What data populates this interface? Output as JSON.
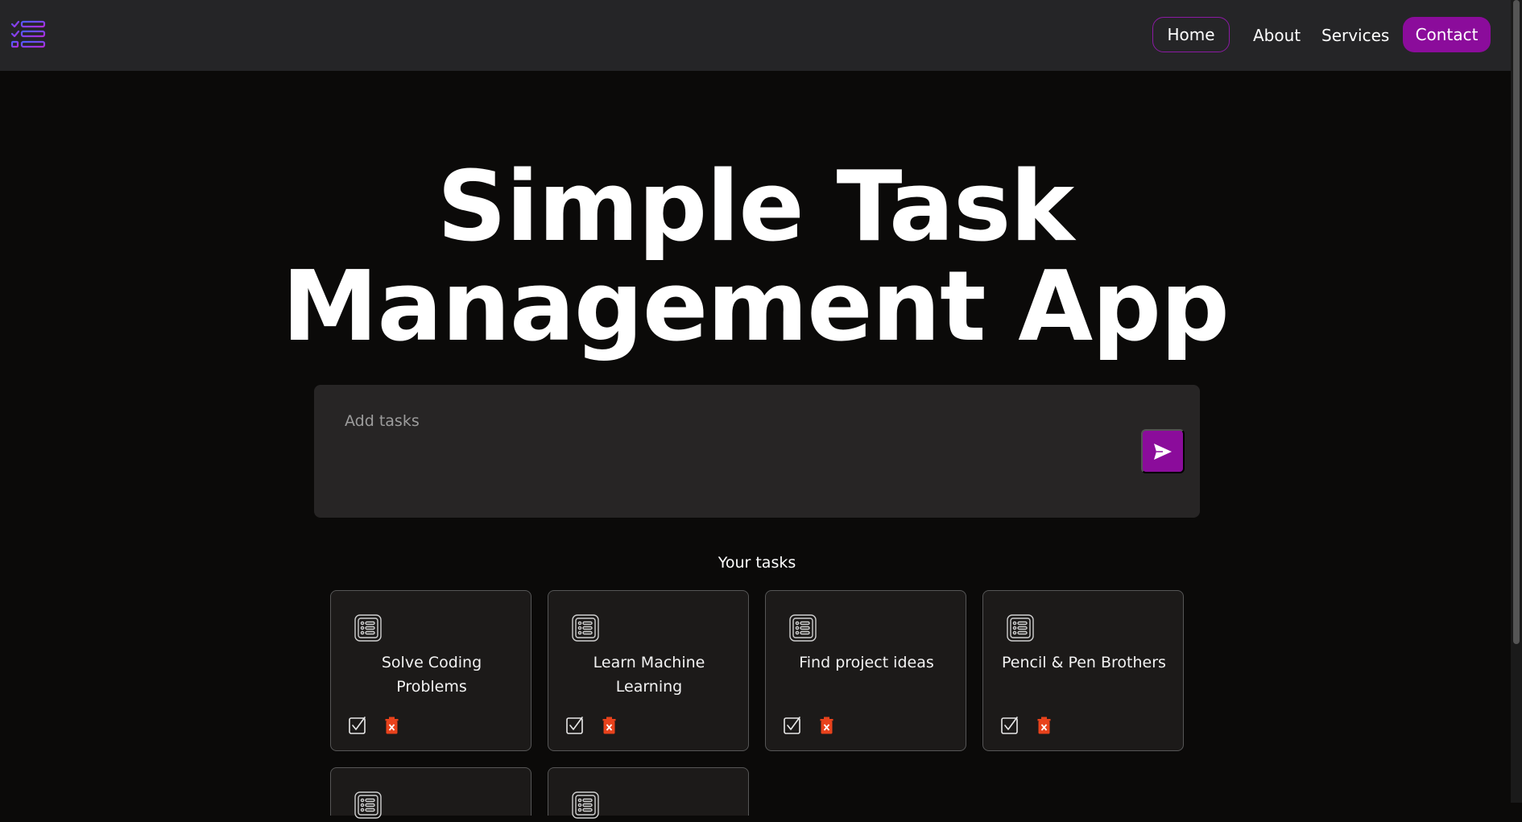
{
  "nav": {
    "logo_icon": "checklist-logo-icon",
    "home": "Home",
    "about": "About",
    "services": "Services",
    "contact": "Contact",
    "accent": "#8b0c9b"
  },
  "hero": {
    "line1": "Simple Task",
    "line2": "Management App"
  },
  "task_input": {
    "placeholder": "Add tasks",
    "value": "",
    "send_icon": "send-icon"
  },
  "tasks_section": {
    "title": "Your tasks",
    "tasks": [
      {
        "title": "Solve Coding Problems"
      },
      {
        "title": "Learn Machine Learning"
      },
      {
        "title": "Find project ideas"
      },
      {
        "title": "Pencil & Pen Brothers"
      },
      {
        "title": ""
      },
      {
        "title": ""
      }
    ]
  }
}
